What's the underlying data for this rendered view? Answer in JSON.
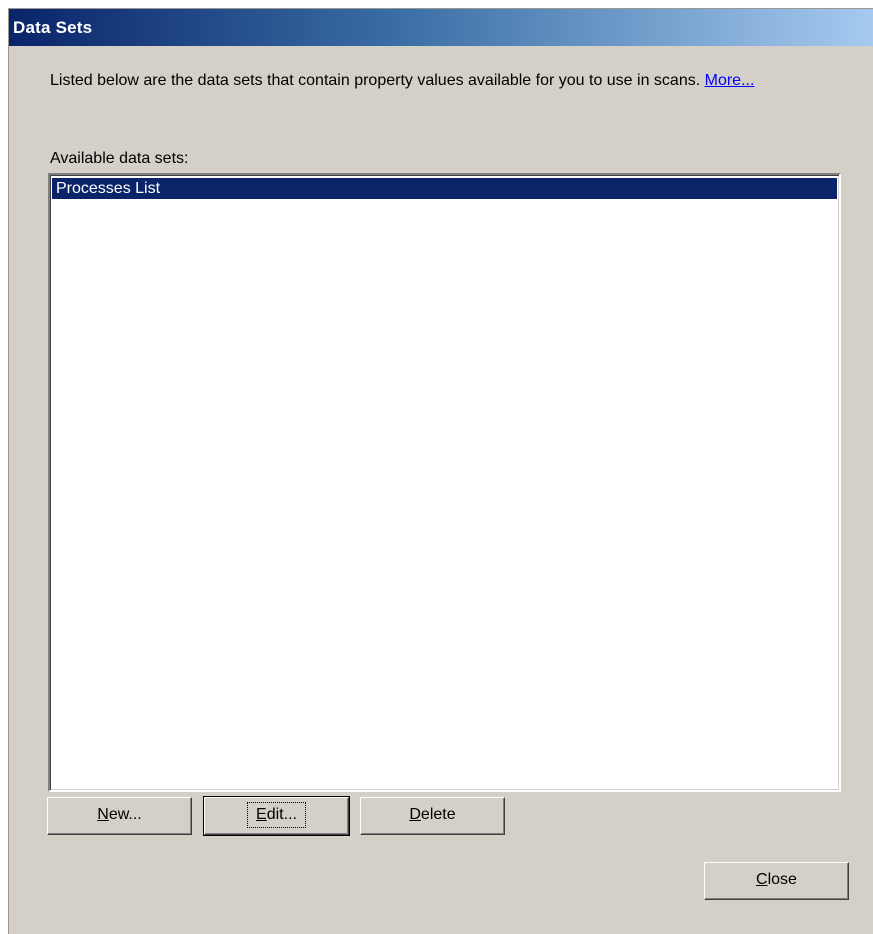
{
  "window": {
    "title": "Data Sets"
  },
  "description": {
    "text": "Listed below are the data sets that contain property values available for you to use in scans.",
    "more_link": "More..."
  },
  "list": {
    "label": "Available data sets:",
    "items": [
      {
        "label": "Processes List",
        "selected": true
      }
    ]
  },
  "buttons": {
    "new": {
      "mnemonic": "N",
      "rest": "ew..."
    },
    "edit": {
      "mnemonic": "E",
      "rest": "dit..."
    },
    "delete": {
      "mnemonic": "D",
      "rest": "elete"
    },
    "close": {
      "mnemonic": "C",
      "rest": "lose"
    }
  },
  "colors": {
    "titlebar_start": "#0a246a",
    "titlebar_end": "#a6caf0",
    "dialog_face": "#d4d0c8",
    "selection": "#0a246a",
    "link": "#0000ff"
  }
}
